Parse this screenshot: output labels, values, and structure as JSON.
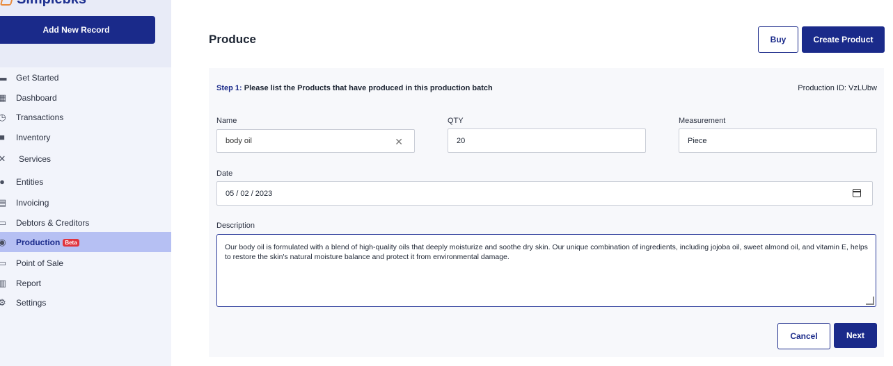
{
  "brand": {
    "name": "Simplebks"
  },
  "sidebar": {
    "add_label": "Add New Record",
    "items": [
      {
        "label": "Get Started",
        "icon": "store-icon"
      },
      {
        "label": "Dashboard",
        "icon": "dashboard-icon"
      },
      {
        "label": "Transactions",
        "icon": "clock-icon"
      },
      {
        "label": "Inventory",
        "icon": "briefcase-icon"
      },
      {
        "label": "Services",
        "icon": "tools-icon"
      },
      {
        "label": "Entities",
        "icon": "person-icon"
      },
      {
        "label": "Invoicing",
        "icon": "invoice-icon"
      },
      {
        "label": "Debtors & Creditors",
        "icon": "ledger-icon"
      },
      {
        "label": "Production",
        "icon": "production-icon",
        "badge": "Beta",
        "active": true
      },
      {
        "label": "Point of Sale",
        "icon": "card-icon"
      },
      {
        "label": "Report",
        "icon": "chart-icon"
      },
      {
        "label": "Settings",
        "icon": "gear-icon"
      }
    ]
  },
  "header": {
    "title": "Produce",
    "buy_label": "Buy",
    "create_label": "Create Product"
  },
  "form": {
    "step_prefix": "Step 1:",
    "step_text": "Please list the Products that have produced in this production batch",
    "production_id": "Production ID: VzLUbw",
    "name_label": "Name",
    "name_value": "body oil",
    "qty_label": "QTY",
    "qty_value": "20",
    "measurement_label": "Measurement",
    "measurement_value": "Piece",
    "date_label": "Date",
    "date_value": "05 / 02 / 2023",
    "description_label": "Description",
    "description_value": "Our body oil is formulated with a blend of high-quality oils that deeply moisturize and soothe dry skin. Our unique combination of ingredients, including jojoba oil, sweet almond oil, and vitamin E, helps to restore the skin's natural moisture balance and protect it from environmental damage.",
    "cancel_label": "Cancel",
    "next_label": "Next"
  },
  "colors": {
    "accent": "#1a2a8a",
    "active_nav": "#b6c0f3",
    "badge": "#e0343d"
  }
}
